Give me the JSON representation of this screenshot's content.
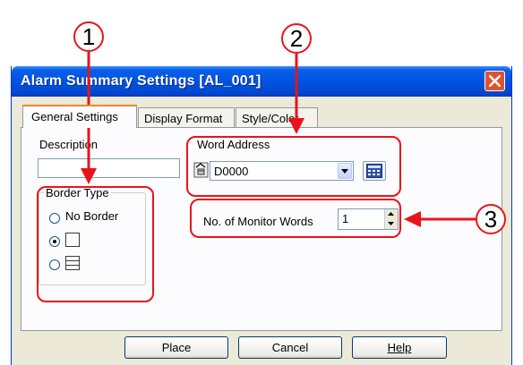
{
  "window": {
    "title": "Alarm Summary Settings [AL_001]",
    "close_symbol": "✕"
  },
  "tabs": [
    {
      "label": "General Settings",
      "active": true
    },
    {
      "label": "Display Format",
      "active": false
    },
    {
      "label": "Style/Color",
      "active": false
    }
  ],
  "general": {
    "description_label": "Description",
    "description_value": "",
    "border_type_label": "Border Type",
    "border_options": [
      {
        "label": "No Border",
        "selected": false,
        "icon": "no-border"
      },
      {
        "label": "",
        "selected": true,
        "icon": "single-frame-icon"
      },
      {
        "label": "",
        "selected": false,
        "icon": "table-frame-icon"
      }
    ],
    "word_address_label": "Word Address",
    "word_address_value": "D0000",
    "monitor_words_label": "No. of Monitor Words",
    "monitor_words_value": "1"
  },
  "buttons": {
    "place": "Place",
    "cancel": "Cancel",
    "help": "Help"
  },
  "callouts": [
    "1",
    "2",
    "3"
  ],
  "colors": {
    "title_bar": "#0054e3",
    "dialog_bg": "#ece9d8",
    "annotation_red": "#e8141b",
    "active_tab_accent": "#e68b2c"
  }
}
